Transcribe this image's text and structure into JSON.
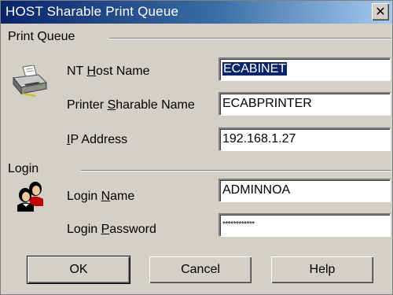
{
  "window": {
    "title": "HOST Sharable Print Queue",
    "close_glyph": "✕"
  },
  "print_queue": {
    "group_label": "Print Queue",
    "icon": "printer-icon",
    "nt_host_name": {
      "label_pre": "NT ",
      "label_key": "H",
      "label_post": "ost Name",
      "value": "ECABINET"
    },
    "printer_sharable_name": {
      "label_pre": "Printer ",
      "label_key": "S",
      "label_post": "harable Name",
      "value": "ECABPRINTER"
    },
    "ip_address": {
      "label_pre": "",
      "label_key": "I",
      "label_post": "P Address",
      "value": "192.168.1.27"
    }
  },
  "login": {
    "group_label": "Login",
    "icon": "users-icon",
    "login_name": {
      "label_pre": "Login ",
      "label_key": "N",
      "label_post": "ame",
      "value": "ADMINNOA"
    },
    "login_password": {
      "label_pre": "Login ",
      "label_key": "P",
      "label_post": "assword",
      "value": "************"
    }
  },
  "buttons": {
    "ok": "OK",
    "cancel": "Cancel",
    "help": "Help"
  },
  "colors": {
    "title_bar_start": "#0a246a",
    "title_bar_end": "#a6caf0",
    "dialog_face": "#d4d0c8",
    "selection": "#0a246a"
  }
}
